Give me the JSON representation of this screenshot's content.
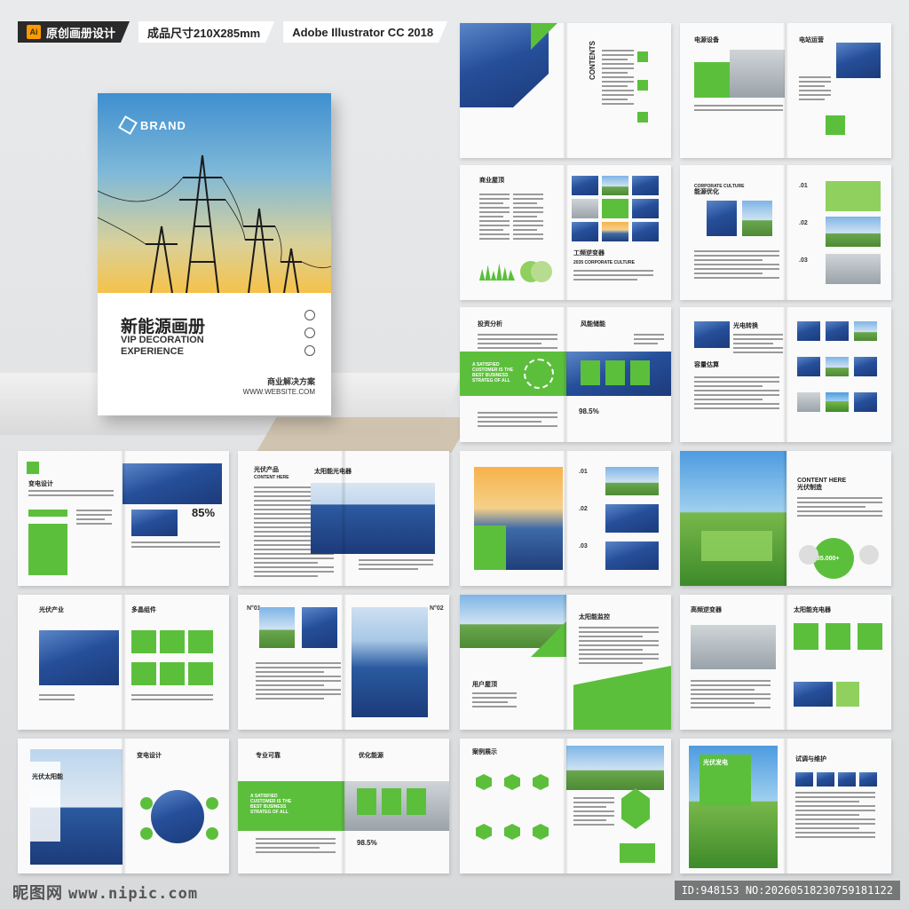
{
  "tags": {
    "ai_badge": "Ai",
    "original": "原创画册设计",
    "size": "成品尺寸210X285mm",
    "software": "Adobe Illustrator CC 2018"
  },
  "cover": {
    "brand": "BRAND",
    "title_cn": "新能源画册",
    "title_en_1": "VIP DECORATION",
    "title_en_2": "EXPERIENCE",
    "footer_cn": "商业解决方案",
    "footer_url": "WWW.WEBSITE.COM"
  },
  "spreads": {
    "contents": "CONTENTS",
    "power_equipment": "电源设备",
    "power_ops": "电站运营",
    "business_roof": "商业屋顶",
    "inverter": "工频逆变器",
    "culture": "2035 CORPORATE CULTURE",
    "corporate_culture": "CORPORATE CULTURE",
    "energy_opt": "能源优化",
    "investment": "投资分析",
    "wind_storage": "风能储能",
    "satisfied": "A SATISFIED CUSTOMER IS THE BEST BUSINESS STRATEG OF ALL",
    "pct_985": "98.5%",
    "pv_convert": "光电转换",
    "capacity": "容量估算",
    "power_design": "变电设计",
    "pct_85": "85%",
    "pv_product": "光伏产品",
    "solar_title": "太阳能光电器",
    "content_here": "CONTENT HERE",
    "pv_manufacture": "光伏制造",
    "stat_85000": "85.000+",
    "pv_industry": "光伏产业",
    "multi_module": "多晶组件",
    "no01": "N°01",
    "no02": "N°02",
    "solar_monitor": "太阳能监控",
    "user_roof": "用户屋顶",
    "freq_inverter": "高频逆变器",
    "solar_device": "太阳能充电器",
    "product_adv": "光伏太阳能",
    "pro_solution": "专业可靠",
    "premium_energy": "优化能源",
    "case_show": "案例展示",
    "pv_power": "光伏发电",
    "trial": "试调与维护"
  },
  "watermark": {
    "site_cn": "昵图网",
    "site_url": "www.nipic.com",
    "id": "ID:948153 NO:20260518230759181122"
  }
}
